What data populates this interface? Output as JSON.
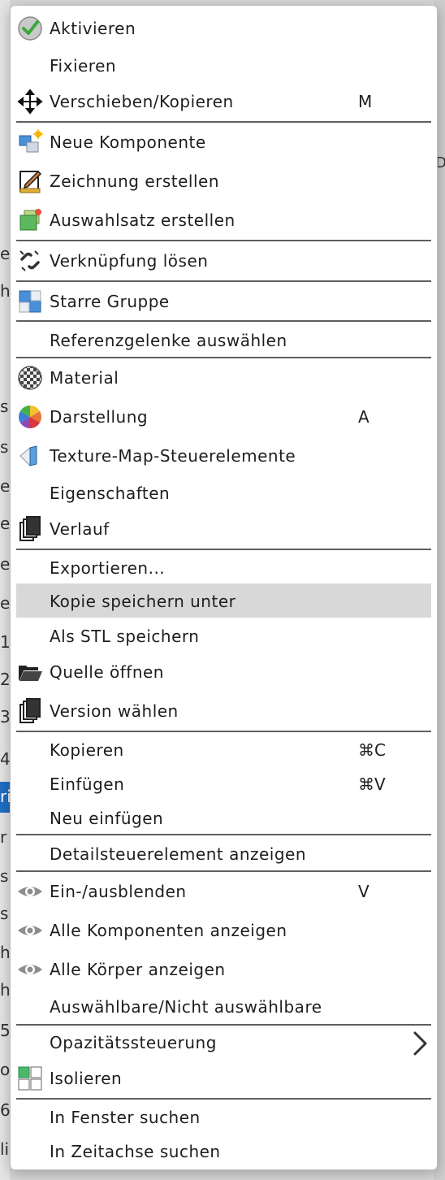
{
  "menu": {
    "items": [
      {
        "label": "Aktivieren",
        "icon": "checkmark-icon"
      },
      {
        "label": "Fixieren"
      },
      {
        "label": "Verschieben/Kopieren",
        "icon": "move-arrows-icon",
        "shortcut": "M"
      },
      {
        "label": "Neue Komponente",
        "icon": "new-component-icon"
      },
      {
        "label": "Zeichnung erstellen",
        "icon": "drawing-icon"
      },
      {
        "label": "Auswahlsatz erstellen",
        "icon": "selection-set-icon"
      },
      {
        "label": "Verknüpfung lösen",
        "icon": "break-link-icon"
      },
      {
        "label": "Starre Gruppe",
        "icon": "rigid-group-icon"
      },
      {
        "label": "Referenzgelenke auswählen"
      },
      {
        "label": "Material",
        "icon": "material-icon"
      },
      {
        "label": "Darstellung",
        "icon": "appearance-icon",
        "shortcut": "A"
      },
      {
        "label": "Texture-Map-Steuerelemente",
        "icon": "texture-map-icon"
      },
      {
        "label": "Eigenschaften"
      },
      {
        "label": "Verlauf",
        "icon": "history-icon"
      },
      {
        "label": "Exportieren..."
      },
      {
        "label": "Kopie speichern unter",
        "highlighted": true
      },
      {
        "label": "Als STL speichern"
      },
      {
        "label": "Quelle öffnen",
        "icon": "folder-open-icon"
      },
      {
        "label": "Version wählen",
        "icon": "versions-icon"
      },
      {
        "label": "Kopieren",
        "shortcut": "⌘C"
      },
      {
        "label": "Einfügen",
        "shortcut": "⌘V"
      },
      {
        "label": "Neu einfügen"
      },
      {
        "label": "Detailsteuerelement anzeigen"
      },
      {
        "label": "Ein-/ausblenden",
        "icon": "eye-icon",
        "shortcut": "V"
      },
      {
        "label": "Alle Komponenten anzeigen",
        "icon": "eye-icon"
      },
      {
        "label": "Alle Körper anzeigen",
        "icon": "eye-icon"
      },
      {
        "label": "Auswählbare/Nicht auswählbare"
      },
      {
        "label": "Opazitätssteuerung",
        "submenu": true
      },
      {
        "label": "Isolieren",
        "icon": "isolate-icon"
      },
      {
        "label": "In Fenster suchen"
      },
      {
        "label": "In Zeitachse suchen"
      }
    ]
  },
  "background": {
    "left_fragments": [
      "e",
      "h",
      "si",
      "si",
      "e",
      "e",
      "e",
      "e",
      "1",
      "2",
      "3",
      "4",
      "ri",
      "r",
      "si",
      "si",
      "h",
      "h",
      "5",
      "o",
      "6",
      "li"
    ],
    "right_fragment": "DE"
  },
  "colors": {
    "highlight": "#d8d8d8",
    "separator": "#5f5f5f",
    "text": "#1e1e1e"
  }
}
